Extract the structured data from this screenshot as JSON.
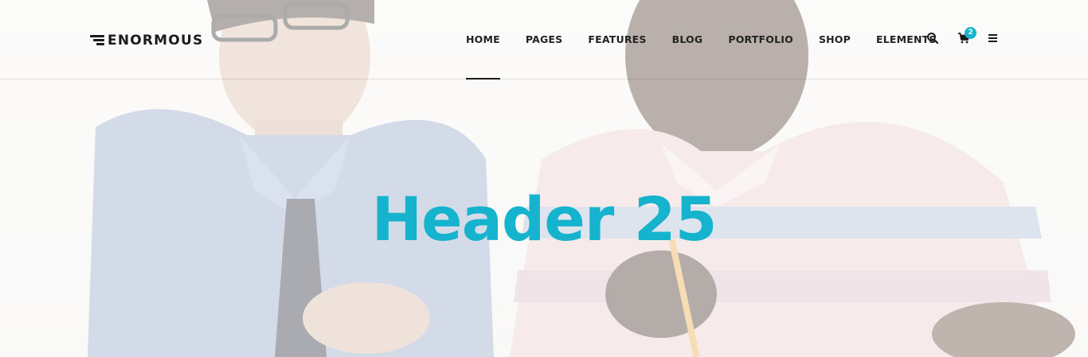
{
  "brand": {
    "name": "ENORMOUS",
    "color": "#1b1b1b"
  },
  "nav": {
    "items": [
      {
        "label": "HOME",
        "active": true
      },
      {
        "label": "PAGES",
        "active": false
      },
      {
        "label": "FEATURES",
        "active": false
      },
      {
        "label": "BLOG",
        "active": false
      },
      {
        "label": "PORTFOLIO",
        "active": false
      },
      {
        "label": "SHOP",
        "active": false
      },
      {
        "label": "ELEMENTS",
        "active": false
      }
    ],
    "icons": [
      "search-icon",
      "cart-icon",
      "menu-icon"
    ]
  },
  "cart": {
    "count": "2",
    "badge_color": "#16b5ce"
  },
  "hero": {
    "title": "Header 25",
    "title_color": "#16b3cf"
  }
}
